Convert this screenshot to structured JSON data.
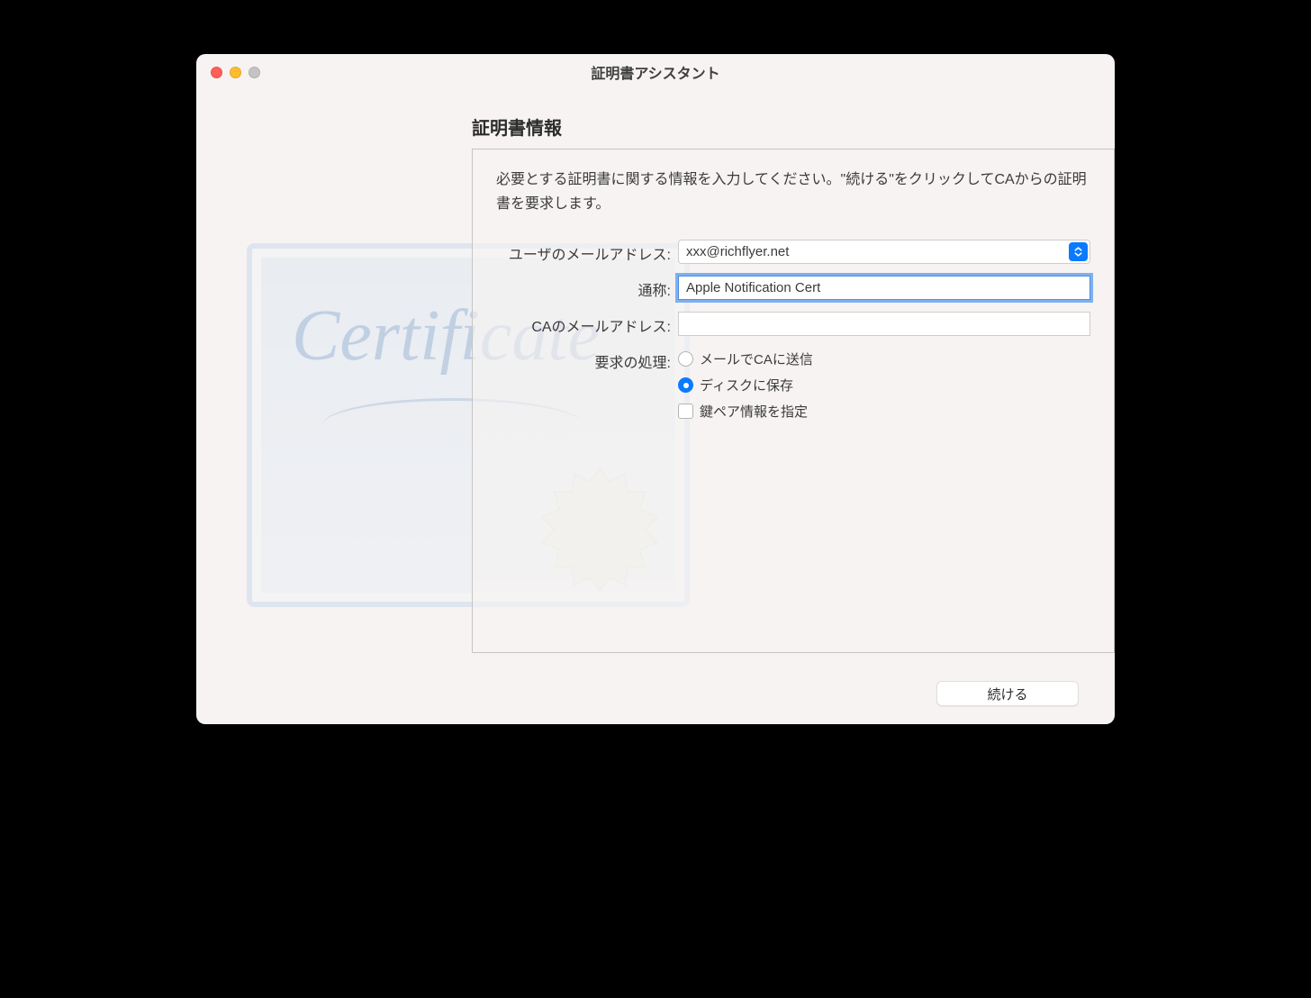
{
  "window": {
    "title": "証明書アシスタント"
  },
  "section": {
    "title": "証明書情報"
  },
  "instructions": "必要とする証明書に関する情報を入力してください。\"続ける\"をクリックしてCAからの証明書を要求します。",
  "fields": {
    "user_email": {
      "label": "ユーザのメールアドレス:",
      "value": "xxx@richflyer.net"
    },
    "common_name": {
      "label": "通称:",
      "value": "Apple Notification Cert"
    },
    "ca_email": {
      "label": "CAのメールアドレス:",
      "value": ""
    },
    "request_handling": {
      "label": "要求の処理:"
    }
  },
  "radios": {
    "email_ca": "メールでCAに送信",
    "save_disk": "ディスクに保存"
  },
  "checkbox": {
    "keypair": "鍵ペア情報を指定"
  },
  "buttons": {
    "continue": "続ける"
  },
  "decor": {
    "script": "Certificate"
  }
}
